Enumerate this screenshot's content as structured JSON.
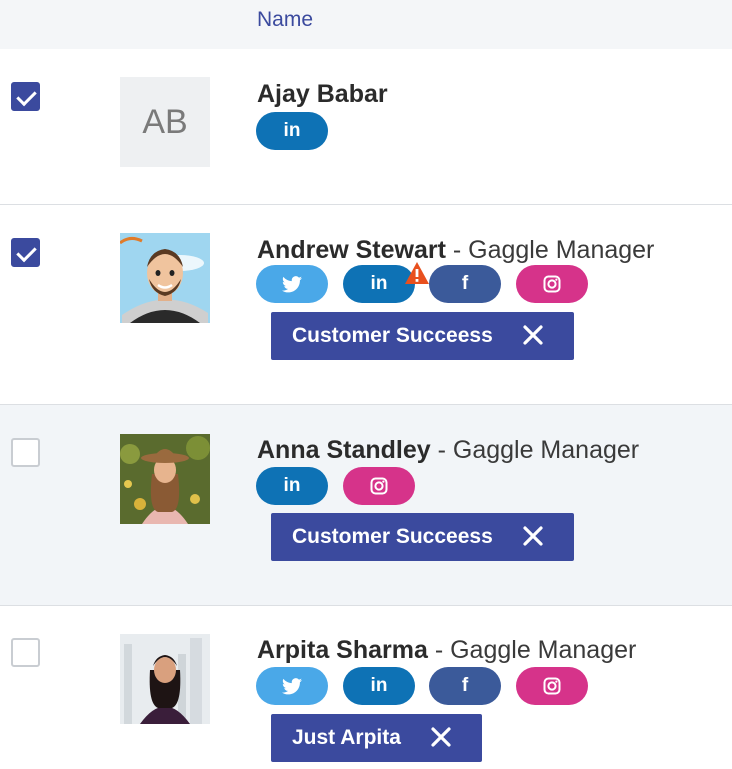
{
  "header": {
    "name_label": "Name"
  },
  "social_glyphs": {
    "twitter": "🐦",
    "linkedin": "in",
    "facebook": "f",
    "instagram": "◎"
  },
  "colors": {
    "accent": "#3b4a9e",
    "twitter": "#4aa8e8",
    "linkedin": "#0e72b5",
    "facebook": "#3b5a9a",
    "instagram": "#d6338a",
    "warning": "#e8501e"
  },
  "rows": [
    {
      "checked": true,
      "avatar": {
        "type": "initials",
        "initials": "AB"
      },
      "name": "Ajay Babar",
      "role": "",
      "socials": [
        "linkedin"
      ],
      "tags": []
    },
    {
      "checked": true,
      "avatar": {
        "type": "photo",
        "icon": "cartoon-avatar"
      },
      "name": "Andrew Stewart",
      "role": " - Gaggle Manager",
      "socials": [
        "twitter",
        "linkedin",
        "facebook",
        "instagram"
      ],
      "linkedin_warning": true,
      "tags": [
        {
          "label": "Customer Succeess",
          "remove_icon": "close-icon"
        }
      ]
    },
    {
      "checked": false,
      "avatar": {
        "type": "photo",
        "icon": "portrait-photo"
      },
      "name": "Anna Standley",
      "role": " - Gaggle Manager",
      "socials": [
        "linkedin",
        "instagram"
      ],
      "tags": [
        {
          "label": "Customer Succeess",
          "remove_icon": "close-icon"
        }
      ]
    },
    {
      "checked": false,
      "avatar": {
        "type": "photo",
        "icon": "portrait-photo"
      },
      "name": "Arpita Sharma",
      "role": " - Gaggle Manager",
      "socials": [
        "twitter",
        "linkedin",
        "facebook",
        "instagram"
      ],
      "tags": [
        {
          "label": "Just Arpita",
          "remove_icon": "close-icon"
        }
      ]
    }
  ]
}
